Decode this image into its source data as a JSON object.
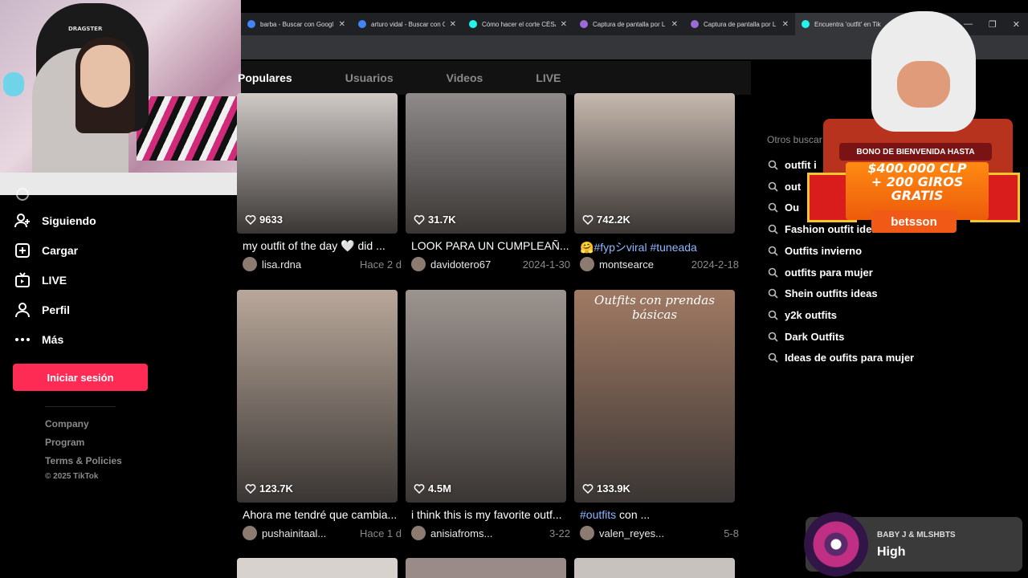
{
  "browser": {
    "tabs": [
      {
        "title": "barba - Buscar con Googl",
        "color": "#4285f4",
        "active": false
      },
      {
        "title": "arturo vidal - Buscar con G",
        "color": "#4285f4",
        "active": false
      },
      {
        "title": "Cómo hacer el corte CÉSA",
        "color": "#25f4ee",
        "active": false
      },
      {
        "title": "Captura de pantalla por L",
        "color": "#9b6bd8",
        "active": false
      },
      {
        "title": "Captura de pantalla por L",
        "color": "#9b6bd8",
        "active": false
      },
      {
        "title": "Encuentra 'outfit' en Tik",
        "color": "#25f4ee",
        "active": true
      }
    ]
  },
  "search_tabs": [
    "Populares",
    "Usuarios",
    "Videos",
    "LIVE"
  ],
  "sidebar": {
    "items": [
      {
        "label": "Siguiendo",
        "icon": "user-plus-icon"
      },
      {
        "label": "Cargar",
        "icon": "upload-icon"
      },
      {
        "label": "LIVE",
        "icon": "live-icon"
      },
      {
        "label": "Perfil",
        "icon": "profile-icon"
      },
      {
        "label": "Más",
        "icon": "more-icon"
      }
    ],
    "login_label": "Iniciar sesión",
    "footer_links": [
      "Company",
      "Program",
      "Terms & Policies"
    ],
    "copyright": "© 2025 TikTok"
  },
  "videos": [
    {
      "likes": "9633",
      "caption": "my outfit of the day 🤍 did ...",
      "caption_tags": "",
      "user": "lisa.rdna",
      "date": "Hace 2 d",
      "bg": "#cfcac6"
    },
    {
      "likes": "31.7K",
      "caption": "LOOK PARA UN CUMPLEAÑ...",
      "caption_tags": "",
      "user": "davidotero67",
      "date": "2024-1-30",
      "bg": "#8e8b8a"
    },
    {
      "likes": "742.2K",
      "caption": "",
      "caption_tags": "🤗#fypシviral #tuneada",
      "user": "montsearce",
      "date": "2024-2-18",
      "bg": "#c6b9ae"
    },
    {
      "likes": "123.7K",
      "caption": "Ahora me tendré que cambia...",
      "caption_tags": "",
      "user": "pushainitaal...",
      "date": "Hace 1 d",
      "bg": "#b9a89a"
    },
    {
      "likes": "4.5M",
      "caption": "i think this is my favorite outf...",
      "caption_tags": "",
      "user": "anisiafroms...",
      "date": "3-22",
      "bg": "#9c948f"
    },
    {
      "likes": "133.9K",
      "caption": " con ...",
      "caption_tags": "#outfits",
      "user": "valen_reyes...",
      "date": "5-8",
      "bg": "#a07a63"
    }
  ],
  "thumb_overlay_text": "Outfits con prendas básicas",
  "related": {
    "heading": "Otros buscar",
    "items": [
      "outfit i",
      "out",
      "Ou",
      "Fashion outfit ideas",
      "Outfits invierno",
      "outfits para mujer",
      "Shein outfits ideas",
      "y2k outfits",
      "Dark Outfits",
      "Ideas de oufits para mujer"
    ]
  },
  "ad": {
    "banner": "BONO DE BIENVENIDA HASTA",
    "amount_line1": "$400.000 CLP",
    "amount_line2": "+ 200 GIROS",
    "amount_line3": "GRATIS",
    "brand": "betsson"
  },
  "webcam": {
    "chair_brand": "DRAGSTER"
  },
  "music": {
    "artist": "BABY J & MLSHBTS",
    "song": "High"
  }
}
